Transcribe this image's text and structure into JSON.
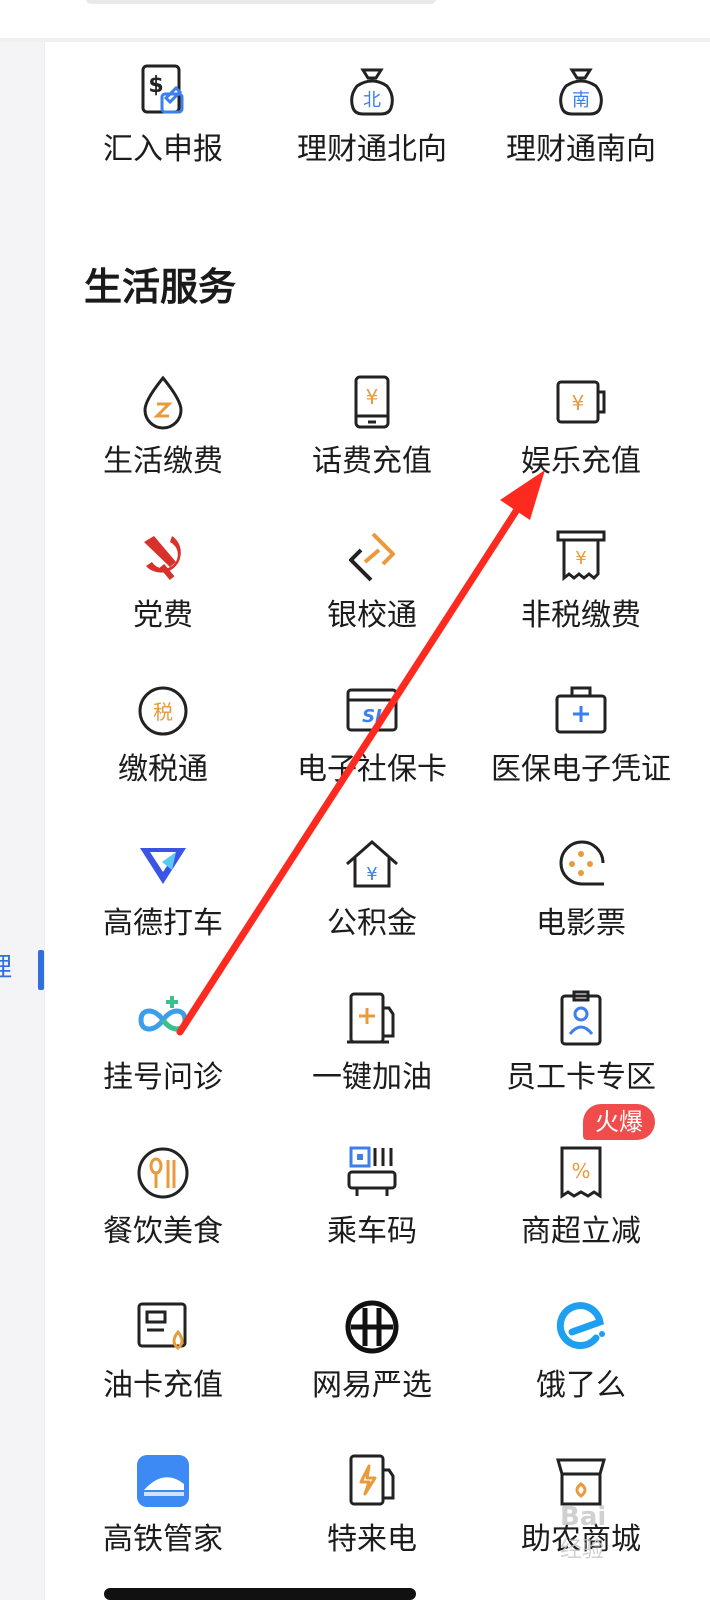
{
  "left_nav": {
    "active_partial_label": "理"
  },
  "top_section": {
    "items": [
      {
        "label": "汇入申报",
        "icon": "dollar-receipt-icon"
      },
      {
        "label": "理财通北向",
        "icon": "moneybag-north-icon",
        "glyph": "北"
      },
      {
        "label": "理财通南向",
        "icon": "moneybag-south-icon",
        "glyph": "南"
      }
    ]
  },
  "life_services": {
    "title": "生活服务",
    "items": [
      {
        "label": "生活缴费",
        "icon": "water-drop-icon"
      },
      {
        "label": "话费充值",
        "icon": "phone-recharge-icon"
      },
      {
        "label": "娱乐充值",
        "icon": "entertainment-recharge-icon"
      },
      {
        "label": "党费",
        "icon": "hammer-sickle-icon"
      },
      {
        "label": "银校通",
        "icon": "bank-school-icon"
      },
      {
        "label": "非税缴费",
        "icon": "receipt-yuan-icon"
      },
      {
        "label": "缴税通",
        "icon": "tax-coin-icon",
        "glyph": "税"
      },
      {
        "label": "电子社保卡",
        "icon": "social-security-card-icon",
        "glyph": "SI"
      },
      {
        "label": "医保电子凭证",
        "icon": "medical-kit-icon"
      },
      {
        "label": "高德打车",
        "icon": "amap-taxi-icon"
      },
      {
        "label": "公积金",
        "icon": "housing-fund-icon"
      },
      {
        "label": "电影票",
        "icon": "movie-ticket-icon"
      },
      {
        "label": "挂号问诊",
        "icon": "hospital-registration-icon"
      },
      {
        "label": "一键加油",
        "icon": "fuel-pump-icon"
      },
      {
        "label": "员工卡专区",
        "icon": "employee-card-icon"
      },
      {
        "label": "餐饮美食",
        "icon": "dining-icon"
      },
      {
        "label": "乘车码",
        "icon": "bus-qr-icon"
      },
      {
        "label": "商超立减",
        "icon": "discount-receipt-icon",
        "badge": "火爆"
      },
      {
        "label": "油卡充值",
        "icon": "fuel-card-icon"
      },
      {
        "label": "网易严选",
        "icon": "netease-yanxuan-icon"
      },
      {
        "label": "饿了么",
        "icon": "eleme-icon"
      },
      {
        "label": "高铁管家",
        "icon": "high-speed-rail-icon"
      },
      {
        "label": "特来电",
        "icon": "ev-charging-icon"
      },
      {
        "label": "助农商城",
        "icon": "farm-store-icon"
      }
    ]
  },
  "watermark": {
    "line1": "Bai",
    "line2": "经验"
  },
  "colors": {
    "accent_blue": "#3d7ef0",
    "accent_orange": "#e89a3c",
    "party_red": "#d8302a",
    "badge_red": "#f04c4c",
    "arrow_red": "#ff2a1f",
    "text": "#1c1c1c"
  }
}
